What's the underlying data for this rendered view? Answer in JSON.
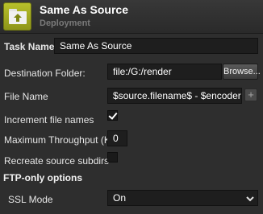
{
  "header": {
    "title": "Same As Source",
    "subtitle": "Deployment",
    "icon": "folder-upload-icon",
    "icon_color": "#a4ab22"
  },
  "task_name": {
    "label": "Task Name:",
    "value": "Same As Source"
  },
  "destination_folder": {
    "label": "Destination Folder:",
    "value": "file:/G:/render",
    "browse_label": "Browse..."
  },
  "file_name": {
    "label": "File Name",
    "value": "$source.filename$ - $encoder.nam",
    "add_label": "+"
  },
  "increment_file_names": {
    "label": "Increment file names",
    "checked": true
  },
  "max_throughput": {
    "label": "Maximum Throughput (KB)",
    "value": "0"
  },
  "recreate_subdirs": {
    "label": "Recreate source subdirs",
    "checked": false
  },
  "ftp_section": {
    "title": "FTP-only options"
  },
  "ssl_mode": {
    "label": "SSL Mode",
    "selected": "On"
  }
}
